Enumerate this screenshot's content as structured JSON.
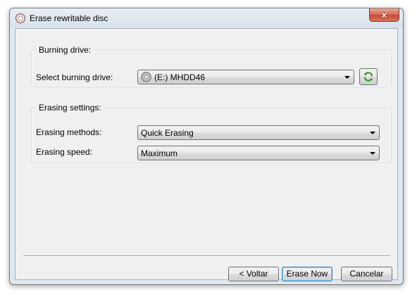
{
  "window": {
    "title": "Erase rewritable disc",
    "close_label": "×"
  },
  "burning_drive": {
    "group_title": "Burning drive:",
    "select_label": "Select burning drive:",
    "drive_value": "(E:) MHDD46"
  },
  "erasing_settings": {
    "group_title": "Erasing settings:",
    "methods_label": "Erasing methods:",
    "methods_value": "Quick Erasing",
    "speed_label": "Erasing speed:",
    "speed_value": "Maximum"
  },
  "buttons": {
    "back_label": "< Voltar",
    "erase_label": "Erase Now",
    "cancel_label": "Cancelar"
  },
  "icons": {
    "app": "disc-icon",
    "drive": "optical-drive-icon",
    "refresh": "refresh-icon"
  },
  "colors": {
    "refresh_green": "#3a9a2a",
    "default_button_border": "#3c7fb1"
  }
}
